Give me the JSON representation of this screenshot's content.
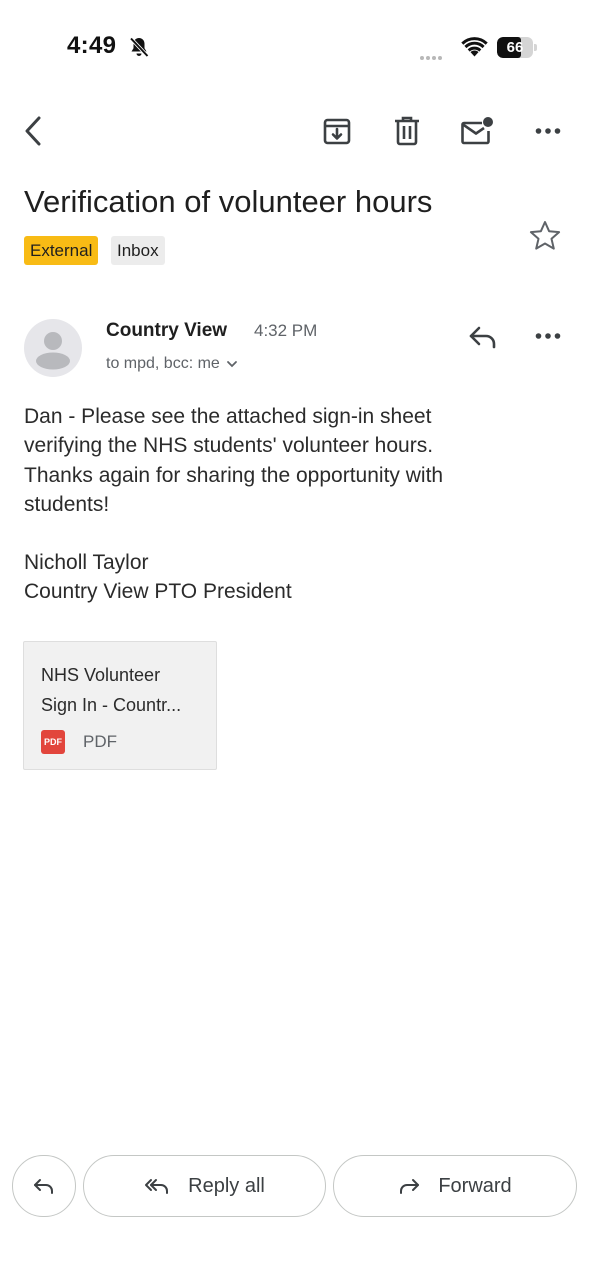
{
  "status_bar": {
    "time": "4:49",
    "battery": "66",
    "battery_level": 0.66
  },
  "toolbar": {
    "back_icon": "chevron-left-icon",
    "archive_icon": "archive-icon",
    "delete_icon": "trash-icon",
    "mark_unread_icon": "mail-unread-icon",
    "more_icon": "more-horizontal-icon"
  },
  "email": {
    "subject": "Verification of volunteer hours",
    "labels": [
      "External",
      "Inbox"
    ],
    "sender": "Country View",
    "time": "4:32 PM",
    "recipients": "to mpd, bcc: me",
    "body": [
      "Dan - Please see the attached sign-in sheet",
      "verifying the NHS students' volunteer hours.",
      "Thanks again for sharing the opportunity with",
      "students!"
    ],
    "signature": [
      "Nicholl Taylor",
      "Country View PTO President"
    ],
    "attachment": {
      "name_line1": "NHS Volunteer",
      "name_line2": "Sign In - Countr...",
      "badge": "PDF",
      "type": "PDF"
    }
  },
  "actions": {
    "reply_all": "Reply all",
    "forward": "Forward"
  },
  "colors": {
    "external_label": "#f8bb15",
    "inbox_label": "#ececec",
    "pdf_icon": "#e2453c"
  }
}
